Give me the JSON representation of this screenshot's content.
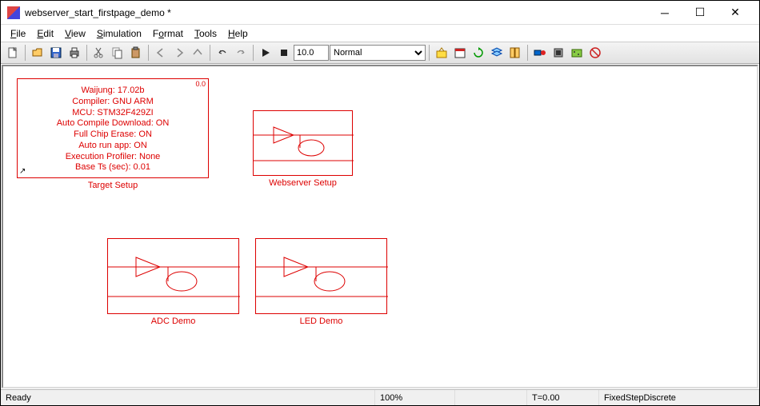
{
  "window": {
    "title": "webserver_start_firstpage_demo *"
  },
  "menus": {
    "file": "File",
    "edit": "Edit",
    "view": "View",
    "simulation": "Simulation",
    "format": "Format",
    "tools": "Tools",
    "help": "Help"
  },
  "toolbar": {
    "step_value": "10.0",
    "mode": "Normal"
  },
  "blocks": {
    "target": {
      "label": "Target Setup",
      "l1": "Waijung: 17.02b",
      "l2": "Compiler: GNU ARM",
      "l3": "MCU: STM32F429ZI",
      "l4": "Auto Compile Download: ON",
      "l5": "Full Chip Erase: ON",
      "l6": "Auto run app: ON",
      "l7": "Execution Profiler: None",
      "l8": "Base Ts (sec): 0.01",
      "corner": "0.0"
    },
    "webserver": {
      "label": "Webserver Setup"
    },
    "adc": {
      "label": "ADC Demo"
    },
    "led": {
      "label": "LED Demo"
    }
  },
  "status": {
    "ready": "Ready",
    "zoom": "100%",
    "time": "T=0.00",
    "solver": "FixedStepDiscrete"
  }
}
